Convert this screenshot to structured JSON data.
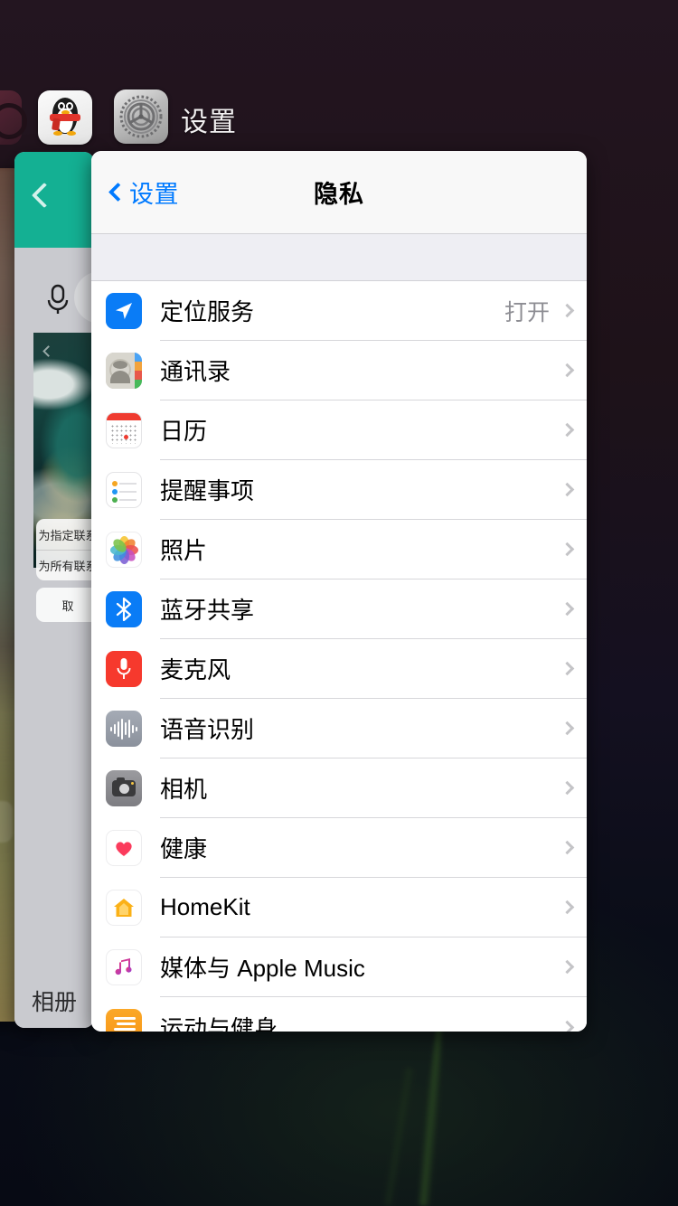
{
  "switcher": {
    "app_title": "设置",
    "app_icons": [
      "qq-app-icon",
      "settings-gear-icon"
    ]
  },
  "middle_card": {
    "back_icon": "back-chevron-icon",
    "mic_icon": "microphone-icon",
    "action_sheet": [
      "为指定联系",
      "为所有联系"
    ],
    "cancel_label": "取",
    "tab_label": "相册"
  },
  "settings_card": {
    "nav": {
      "back_label": "设置",
      "title": "隐私",
      "back_icon": "chevron-left-icon"
    },
    "rows": [
      {
        "label": "定位服务",
        "value": "打开",
        "icon": "location-services-icon"
      },
      {
        "label": "通讯录",
        "value": "",
        "icon": "contacts-icon"
      },
      {
        "label": "日历",
        "value": "",
        "icon": "calendar-icon"
      },
      {
        "label": "提醒事项",
        "value": "",
        "icon": "reminders-icon"
      },
      {
        "label": "照片",
        "value": "",
        "icon": "photos-icon"
      },
      {
        "label": "蓝牙共享",
        "value": "",
        "icon": "bluetooth-icon"
      },
      {
        "label": "麦克风",
        "value": "",
        "icon": "microphone-icon"
      },
      {
        "label": "语音识别",
        "value": "",
        "icon": "speech-recognition-icon"
      },
      {
        "label": "相机",
        "value": "",
        "icon": "camera-icon"
      },
      {
        "label": "健康",
        "value": "",
        "icon": "health-icon"
      },
      {
        "label": "HomeKit",
        "value": "",
        "icon": "homekit-icon"
      },
      {
        "label": "媒体与 Apple Music",
        "value": "",
        "icon": "apple-music-icon"
      },
      {
        "label": "运动与健身",
        "value": "",
        "icon": "fitness-icon"
      }
    ]
  },
  "colors": {
    "accent_blue": "#007aff",
    "teal_header": "#14b093",
    "background": "#1e1219",
    "group_gap": "#eeeef3"
  }
}
